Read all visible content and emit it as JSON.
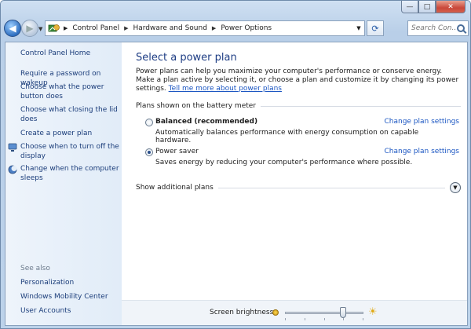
{
  "window": {
    "minimize": "—",
    "maximize": "□",
    "close": "✕"
  },
  "address": {
    "crumbs": [
      "Control Panel",
      "Hardware and Sound",
      "Power Options"
    ],
    "search_placeholder": "Search Con..."
  },
  "sidebar": {
    "home": "Control Panel Home",
    "items": [
      {
        "label": "Require a password on wakeup",
        "icon": null
      },
      {
        "label": "Choose what the power button does",
        "icon": null
      },
      {
        "label": "Choose what closing the lid does",
        "icon": null
      },
      {
        "label": "Create a power plan",
        "icon": null
      },
      {
        "label": "Choose when to turn off the display",
        "icon": "display-icon"
      },
      {
        "label": "Change when the computer sleeps",
        "icon": "moon-icon"
      }
    ],
    "see_also": "See also",
    "see_also_items": [
      "Personalization",
      "Windows Mobility Center",
      "User Accounts"
    ]
  },
  "main": {
    "title": "Select a power plan",
    "intro": "Power plans can help you maximize your computer's performance or conserve energy. Make a plan active by selecting it, or choose a plan and customize it by changing its power settings.",
    "intro_link": "Tell me more about power plans",
    "group_label": "Plans shown on the battery meter",
    "plans": [
      {
        "name": "Balanced (recommended)",
        "desc": "Automatically balances performance with energy consumption on capable hardware.",
        "link": "Change plan settings",
        "selected": false
      },
      {
        "name": "Power saver",
        "desc": "Saves energy by reducing your computer's performance where possible.",
        "link": "Change plan settings",
        "selected": true
      }
    ],
    "show_additional": "Show additional plans"
  },
  "footer": {
    "brightness_label": "Screen brightness:",
    "brightness_level": 0.75
  },
  "colors": {
    "link": "#1b56c2",
    "title": "#1e3d84",
    "sidebar_link": "#1b3d7a"
  }
}
